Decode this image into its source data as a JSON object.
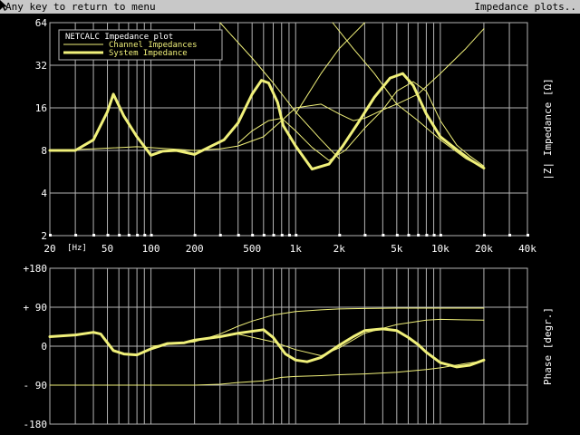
{
  "status_bar": {
    "left_text": "Any key to return to menu",
    "right_text": "Impedance plots..",
    "icon": "mouse-pointer-icon"
  },
  "colors": {
    "background": "#000000",
    "grid": "#b4b4b4",
    "curve": "#f0f07a",
    "axis_text": "#ffffff",
    "status_bar": "#c8c8c8"
  },
  "legend": {
    "title": "NETCALC  Impedance plot",
    "entries": [
      "Channel Impedances",
      "System Impedance"
    ]
  },
  "freq_axis": {
    "unit_label": "[Hz]",
    "tick_values": [
      20,
      50,
      100,
      200,
      500,
      1000,
      2000,
      5000,
      10000,
      20000,
      40000
    ],
    "tick_labels": [
      "20",
      "50",
      "100",
      "200",
      "500",
      "1k",
      "2k",
      "5k",
      "10k",
      "20k",
      "40k"
    ]
  },
  "chart_data": [
    {
      "type": "line",
      "title": "NETCALC  Impedance plot",
      "xlabel": "[Hz]",
      "ylabel": "|Z| Impedance [Ω]",
      "x_scale": "log",
      "y_scale": "log2",
      "xlim": [
        20,
        40000
      ],
      "ylim": [
        2,
        64
      ],
      "yticks": [
        2,
        4,
        8,
        16,
        32,
        64
      ],
      "ytick_labels": [
        "2",
        "4",
        "8",
        "16",
        "32",
        "64"
      ],
      "grid": true,
      "legend_position": "top-left",
      "series": [
        {
          "name": "System Impedance",
          "x": [
            20,
            30,
            40,
            50,
            55,
            65,
            80,
            100,
            120,
            150,
            200,
            250,
            320,
            400,
            500,
            580,
            650,
            750,
            820,
            1000,
            1300,
            1700,
            2100,
            2700,
            3500,
            4500,
            5500,
            6500,
            8000,
            10000,
            13000,
            16000,
            20000
          ],
          "y": [
            8,
            8,
            9.5,
            15,
            20,
            14,
            10,
            7.4,
            7.9,
            8,
            7.5,
            8.4,
            9.5,
            12.5,
            20,
            25,
            24,
            17.5,
            12,
            8.6,
            5.9,
            6.4,
            8.5,
            12.5,
            19,
            26,
            28,
            23,
            14.5,
            10,
            8.1,
            6.9,
            6
          ]
        },
        {
          "name": "Channel Impedances",
          "x": [
            20,
            40,
            80,
            200,
            300,
            400,
            600,
            800,
            1000,
            1500,
            2000,
            2500,
            3000,
            4000,
            5000,
            7000,
            10000,
            15000,
            20000
          ],
          "y": [
            8,
            8.2,
            8.5,
            8,
            8.2,
            8.6,
            10,
            13,
            16,
            17,
            14.5,
            13,
            13.5,
            15.5,
            17,
            20,
            28,
            42,
            58
          ]
        },
        {
          "name": "Channel Impedances",
          "x": [
            400,
            500,
            650,
            800,
            1000,
            1300,
            1700,
            2200,
            3000,
            4000,
            5000,
            6500,
            8000,
            10000,
            13000,
            16000,
            20000
          ],
          "y": [
            9,
            11,
            13,
            13.5,
            11,
            8.4,
            6.8,
            8,
            11.5,
            15.5,
            21,
            24.5,
            21,
            13,
            8.7,
            7.3,
            6.2
          ]
        },
        {
          "name": "Channel Impedances",
          "x": [
            300,
            500,
            700,
            1000,
            1500,
            2000
          ],
          "y": [
            64,
            36,
            24,
            15,
            9.5,
            7
          ]
        },
        {
          "name": "Channel Impedances",
          "x": [
            1800,
            2500,
            3500,
            5000,
            7000,
            10000,
            15000,
            20000
          ],
          "y": [
            64,
            42,
            28,
            17,
            13,
            9.5,
            7,
            6
          ]
        },
        {
          "name": "Channel Impedances",
          "x": [
            1000,
            1500,
            2000,
            3000
          ],
          "y": [
            14.5,
            28,
            42,
            64
          ]
        }
      ]
    },
    {
      "type": "line",
      "xlabel": "[Hz]",
      "ylabel": "Phase [degr.]",
      "x_scale": "log",
      "xlim": [
        20,
        40000
      ],
      "ylim": [
        -180,
        180
      ],
      "yticks": [
        -180,
        -90,
        0,
        90,
        180
      ],
      "ytick_labels": [
        "-180",
        "- 90",
        "0",
        "+ 90",
        "+180"
      ],
      "grid": true,
      "series": [
        {
          "name": "System Impedance",
          "x": [
            20,
            30,
            40,
            45,
            55,
            65,
            80,
            100,
            130,
            170,
            200,
            300,
            400,
            600,
            700,
            850,
            1000,
            1200,
            1500,
            2000,
            2500,
            3000,
            4000,
            5000,
            6000,
            7000,
            8000,
            10000,
            13000,
            16000,
            20000
          ],
          "y": [
            22,
            26,
            32,
            28,
            -10,
            -18,
            -20,
            -6,
            6,
            8,
            14,
            22,
            30,
            38,
            20,
            -18,
            -32,
            -36,
            -26,
            2,
            22,
            36,
            40,
            36,
            20,
            4,
            -14,
            -38,
            -48,
            -44,
            -32
          ]
        },
        {
          "name": "Channel Impedances",
          "x": [
            20,
            100,
            200,
            300,
            400,
            600,
            800,
            1000,
            1500,
            2000,
            3000,
            5000,
            8000,
            10000,
            15000,
            20000
          ],
          "y": [
            -90,
            -90,
            -90,
            -88,
            -84,
            -80,
            -72,
            -70,
            -68,
            -66,
            -64,
            -60,
            -54,
            -50,
            -40,
            -34
          ]
        },
        {
          "name": "Channel Impedances",
          "x": [
            100,
            200,
            300,
            400,
            500,
            700,
            1000,
            1500,
            2000,
            3000,
            5000,
            10000,
            20000
          ],
          "y": [
            0,
            10,
            28,
            46,
            58,
            72,
            80,
            84,
            86,
            87,
            88,
            88,
            88
          ]
        },
        {
          "name": "Channel Impedances",
          "x": [
            400,
            700,
            1000,
            1500,
            2000,
            3000,
            5000,
            8000,
            10000,
            20000
          ],
          "y": [
            28,
            10,
            -8,
            -22,
            -4,
            30,
            50,
            60,
            62,
            60
          ]
        }
      ]
    }
  ]
}
